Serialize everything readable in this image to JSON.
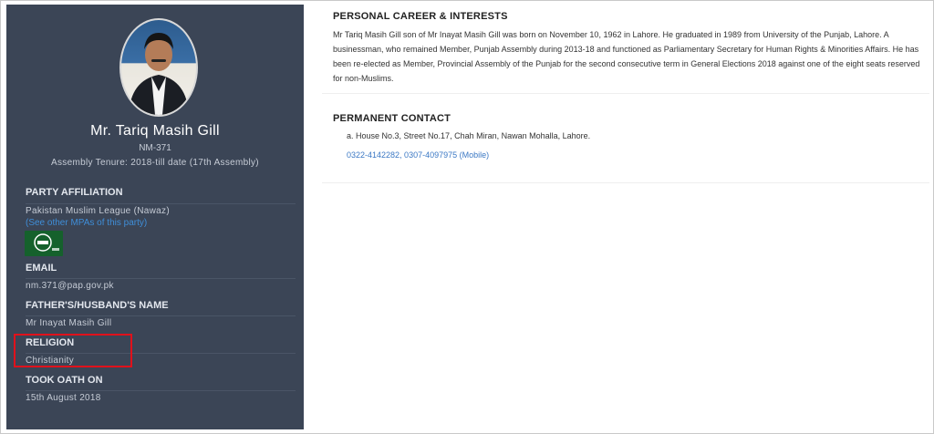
{
  "profile": {
    "name": "Mr. Tariq Masih Gill",
    "code": "NM-371",
    "tenure": "Assembly Tenure: 2018-till date (17th Assembly)"
  },
  "party": {
    "label": "PARTY AFFILIATION",
    "value": "Pakistan Muslim League (Nawaz)",
    "link": "(See other MPAs of this party)",
    "logo_icon": "pml-n-logo"
  },
  "email": {
    "label": "EMAIL",
    "value": "nm.371@pap.gov.pk"
  },
  "father": {
    "label": "FATHER'S/HUSBAND'S NAME",
    "value": "Mr Inayat Masih Gill"
  },
  "religion": {
    "label": "RELIGION",
    "value": "Christianity"
  },
  "oath": {
    "label": "TOOK OATH ON",
    "value": "15th August 2018"
  },
  "career": {
    "title": "PERSONAL CAREER & INTERESTS",
    "text": "Mr Tariq Masih Gill son of Mr Inayat Masih Gill was born on November 10, 1962 in Lahore. He graduated in 1989 from University of the Punjab, Lahore. A businessman, who remained Member, Punjab Assembly during 2013-18 and functioned as Parliamentary Secretary for Human Rights & Minorities Affairs. He has been re-elected as Member, Provincial Assembly of the Punjab for the second consecutive term in General Elections 2018 against one of the eight seats reserved for non-Muslims."
  },
  "contact": {
    "title": "PERMANENT CONTACT",
    "address": "a. House No.3, Street No.17, Chah Miran, Nawan Mohalla, Lahore.",
    "phones": "0322-4142282, 0307-4097975 (Mobile)"
  },
  "colors": {
    "sidebar_bg": "#3b4556",
    "link": "#3f8ed8",
    "highlight_border": "#e0111b",
    "party_logo_bg": "#15612c"
  }
}
